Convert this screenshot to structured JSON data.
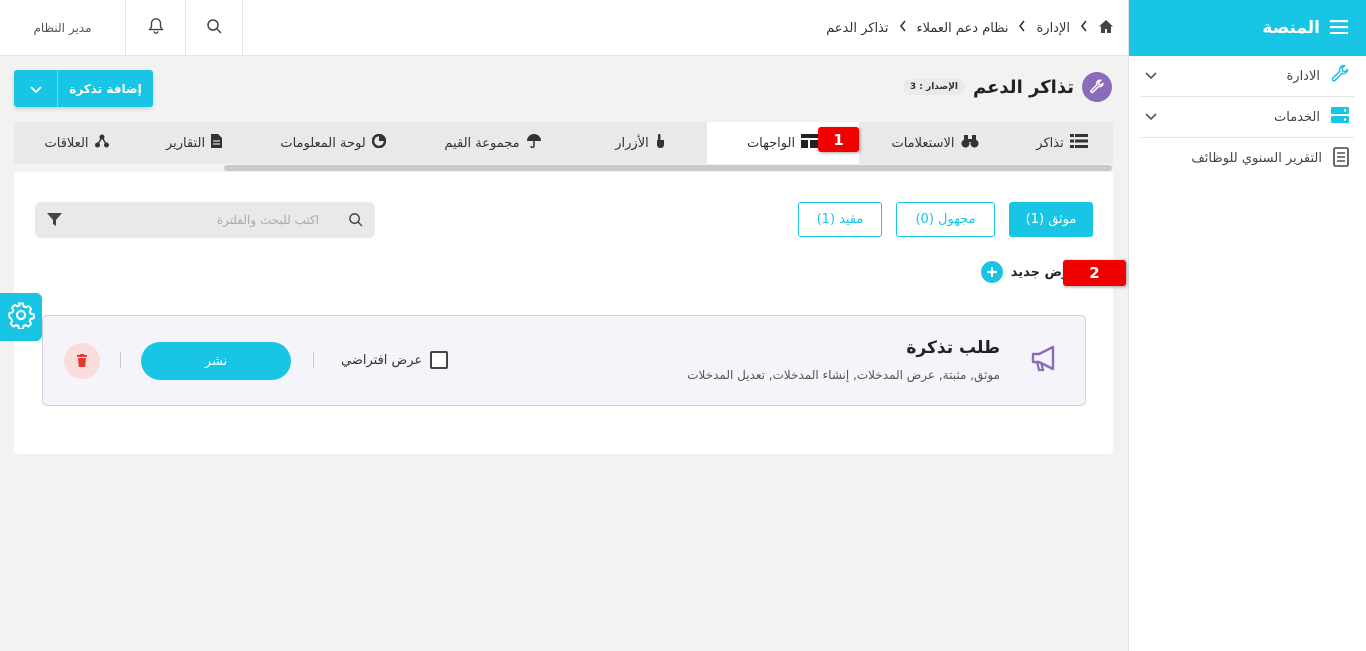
{
  "sidebar": {
    "title": "المنصة",
    "items": [
      {
        "label": "الادارة",
        "icon": "wrench-icon",
        "has_children": true
      },
      {
        "label": "الخدمات",
        "icon": "server-icon",
        "has_children": true
      },
      {
        "label": "التقرير السنوي للوظائف",
        "icon": "document-icon",
        "has_children": false
      }
    ]
  },
  "topbar": {
    "user_label": "مدير النظام",
    "breadcrumb": [
      "الإدارة",
      "نظام دعم العملاء",
      "تذاكر الدعم"
    ]
  },
  "page": {
    "title": "تذاكر الدعم",
    "version_badge": "الإصدار : 3",
    "add_button": "إضافة تذكرة"
  },
  "tabs": [
    {
      "label": "تذاكر",
      "icon": "list-icon",
      "active": false
    },
    {
      "label": "الاستعلامات",
      "icon": "binoculars-icon",
      "active": false
    },
    {
      "label": "الواجهات",
      "icon": "layout-icon",
      "active": true
    },
    {
      "label": "الأزرار",
      "icon": "pointer-icon",
      "active": false
    },
    {
      "label": "مجموعة القيم",
      "icon": "umbrella-icon",
      "active": false
    },
    {
      "label": "لوحة المعلومات",
      "icon": "dashboard-icon",
      "active": false
    },
    {
      "label": "التقارير",
      "icon": "file-icon",
      "active": false
    },
    {
      "label": "العلاقات",
      "icon": "network-icon",
      "active": false
    }
  ],
  "markers": {
    "m1": "1",
    "m2": "2"
  },
  "filters": {
    "trusted": "موثق (1)",
    "unknown": "مجهول (0)",
    "restricted": "مقيد (1)"
  },
  "search": {
    "placeholder": "اكتب للبحث والفلترة"
  },
  "new_view_label": "عرض جديد",
  "card": {
    "title": "طلب تذكرة",
    "subtitle": "موثق, مثبتة, عرض المدخلات, إنشاء المدخلات, تعديل المدخلات",
    "default_label": "عرض افتراضي",
    "publish_label": "نشر"
  },
  "colors": {
    "accent": "#19c5e4",
    "title_icon_bg": "#8b6cba",
    "marker": "#f10000"
  }
}
